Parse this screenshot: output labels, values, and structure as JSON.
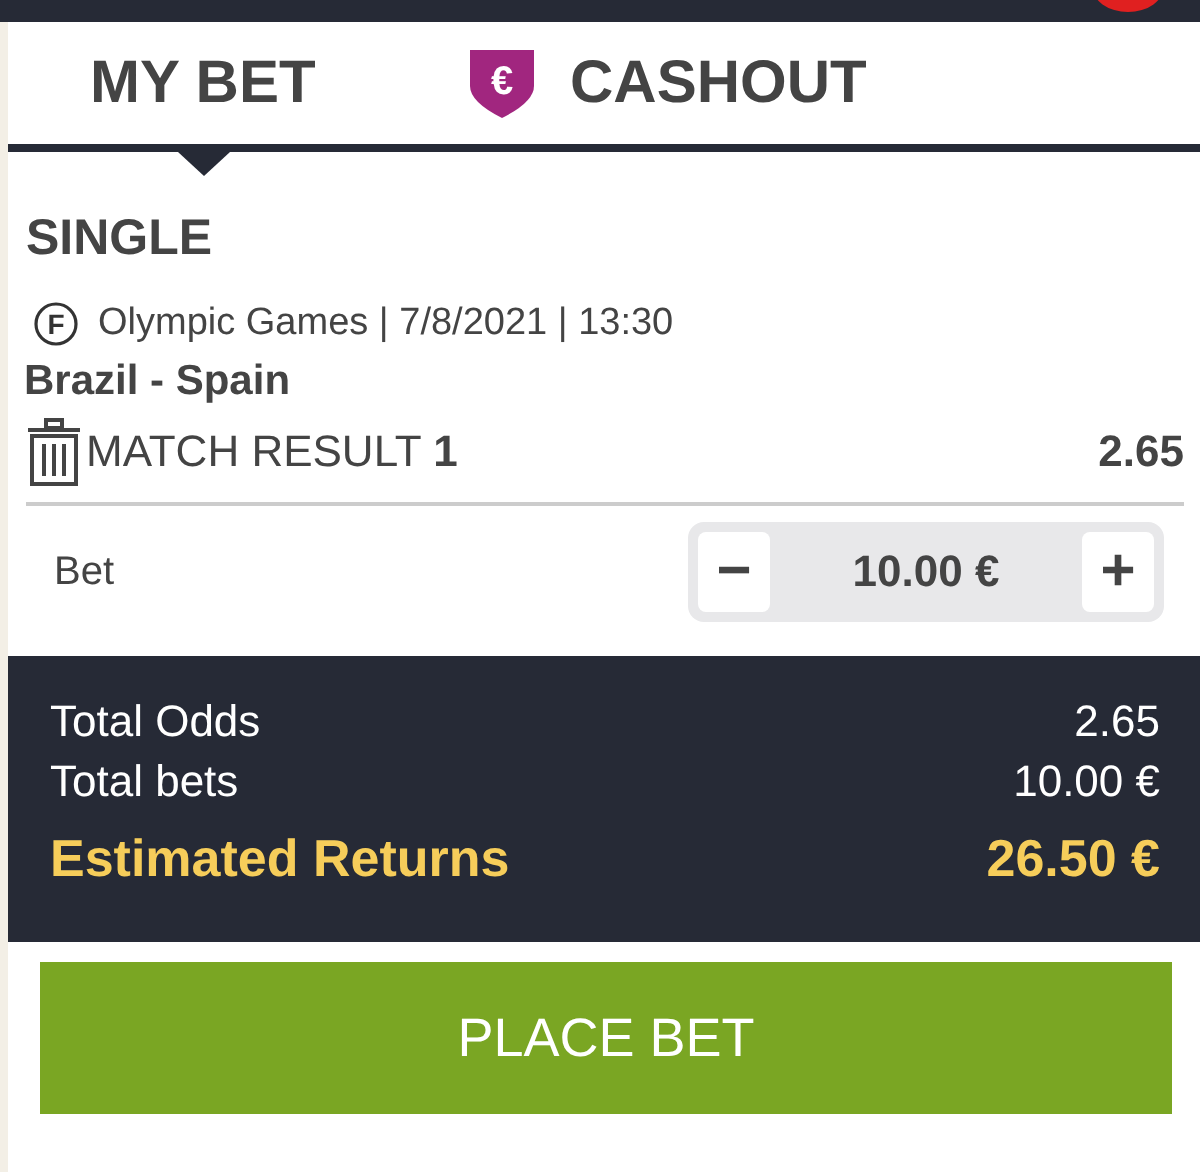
{
  "tabs": [
    {
      "label": "MY BET",
      "selected": true,
      "kind": "plain"
    },
    {
      "label": "CASHOUT",
      "selected": false,
      "kind": "cashout",
      "icon_symbol": "€"
    }
  ],
  "bet_type": "SINGLE",
  "selection": {
    "sport_symbol": "F",
    "event_info": "Olympic Games | 7/8/2021 | 13:30",
    "teams": "Brazil - Spain",
    "market": "MATCH RESULT **1**",
    "odds": "2.65"
  },
  "stake": {
    "label": "Bet",
    "minus": "−",
    "value": "10.00 €",
    "plus": "+"
  },
  "summary": [
    {
      "label": "Total Odds",
      "value": "2.65",
      "highlight": false
    },
    {
      "label": "Total bets",
      "value": "10.00 €",
      "highlight": false
    },
    {
      "label": "Estimated Returns",
      "value": "26.50 €",
      "highlight": true
    }
  ],
  "place_bet_button": "PLACE BET"
}
